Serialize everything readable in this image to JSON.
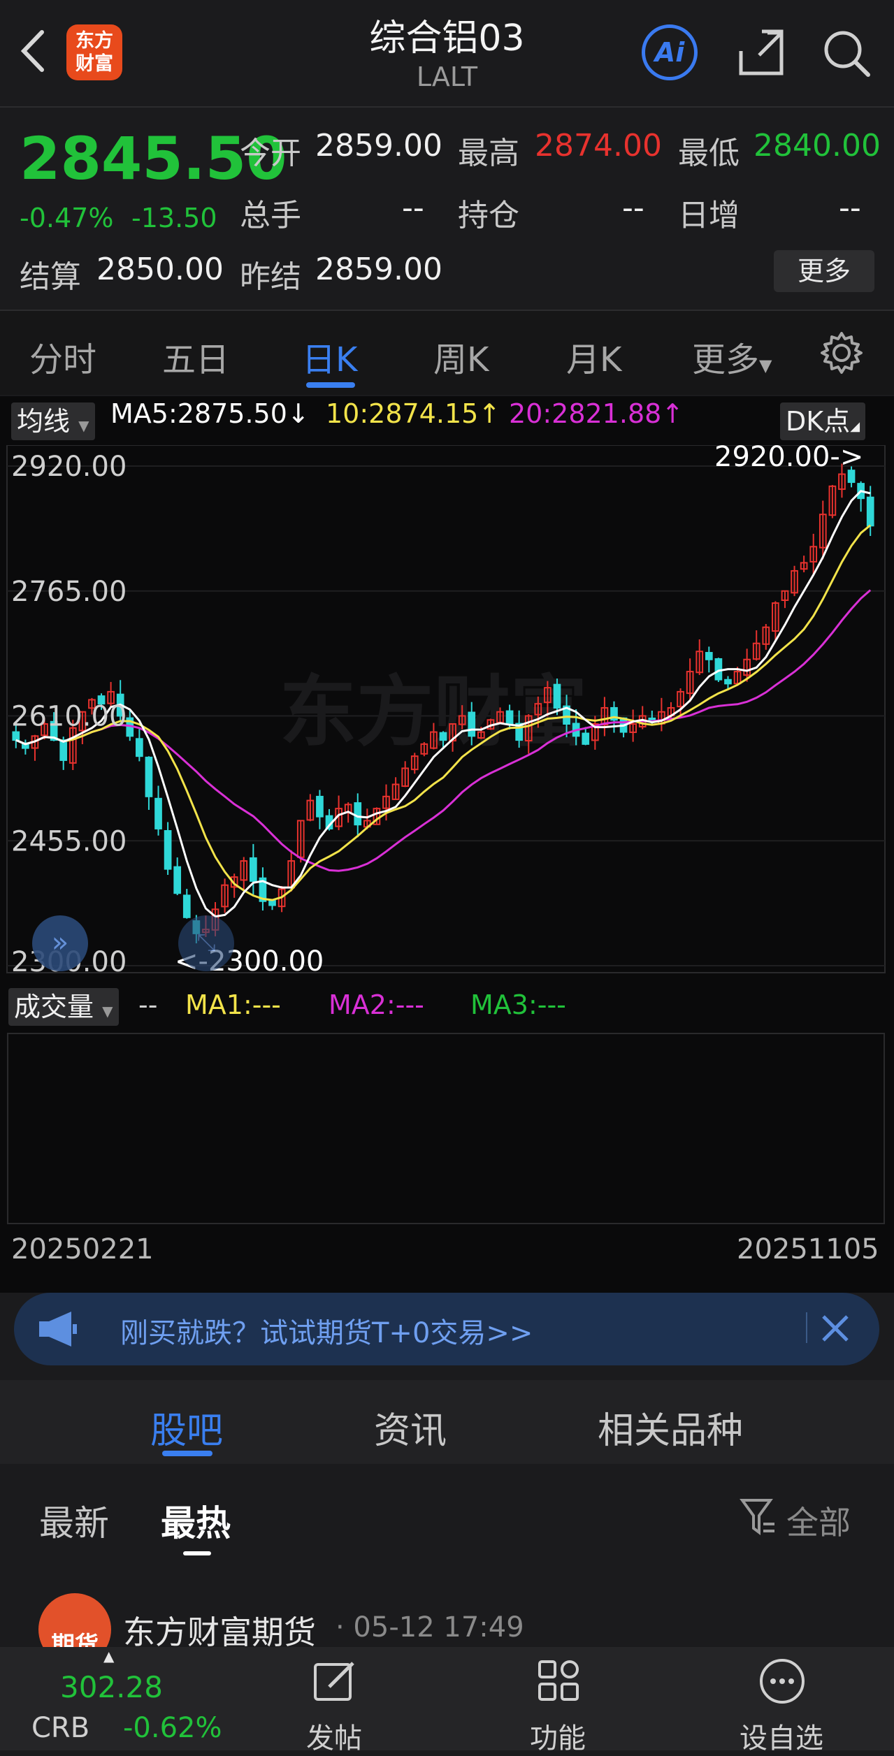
{
  "header": {
    "back_icon": "chevron-left-icon",
    "logo_line1": "东方",
    "logo_line2": "财富",
    "title": "综合铝03",
    "subtitle": "LALT",
    "ai_label": "Ai",
    "share_icon": "share-icon",
    "search_icon": "search-icon"
  },
  "quote": {
    "price": "2845.50",
    "change_pct": "-0.47%",
    "change_abs": "-13.50",
    "open_label": "今开",
    "open": "2859.00",
    "high_label": "最高",
    "high": "2874.00",
    "low_label": "最低",
    "low": "2840.00",
    "volume_label": "总手",
    "volume": "--",
    "oi_label": "持仓",
    "oi": "--",
    "daily_inc_label": "日增",
    "daily_inc": "--",
    "settle_label": "结算",
    "settle": "2850.00",
    "prev_settle_label": "昨结",
    "prev_settle": "2859.00",
    "more_label": "更多"
  },
  "period_tabs": [
    "分时",
    "五日",
    "日K",
    "周K",
    "月K",
    "更多"
  ],
  "active_period": "日K",
  "chart_legend": {
    "ma_button": "均线",
    "ma5": "MA5:2875.50↓",
    "ma10": "10:2874.15↑",
    "ma20": "20:2821.88↑",
    "dk_button": "DK点",
    "vol_button": "成交量",
    "vol_dash": "--",
    "vol_ma1": "MA1:---",
    "vol_ma2": "MA2:---",
    "vol_ma3": "MA3:---",
    "high_marker": "2920.00->",
    "low_marker": "<-2300.00",
    "watermark": "东方财富",
    "date_start": "20250221",
    "date_end": "20251105"
  },
  "colors": {
    "up": "#e8322e",
    "down": "#2fd8d8",
    "ma5": "#ffffff",
    "ma10": "#f2e34a",
    "ma20": "#d930d6",
    "accent": "#3a7ff0"
  },
  "chart_data": {
    "type": "candlestick",
    "ylim": [
      2300,
      2920
    ],
    "y_ticks": [
      "2920.00",
      "2765.00",
      "2610.00",
      "2455.00",
      "2300.00"
    ],
    "x_range": [
      "20250221",
      "20251105"
    ],
    "close_estimate": [
      2580,
      2570,
      2585,
      2600,
      2580,
      2555,
      2595,
      2615,
      2630,
      2625,
      2640,
      2610,
      2585,
      2560,
      2510,
      2470,
      2420,
      2390,
      2360,
      2340,
      2345,
      2370,
      2400,
      2410,
      2430,
      2405,
      2380,
      2375,
      2395,
      2430,
      2480,
      2505,
      2485,
      2470,
      2495,
      2500,
      2475,
      2480,
      2495,
      2510,
      2525,
      2545,
      2560,
      2575,
      2590,
      2580,
      2600,
      2610,
      2585,
      2590,
      2605,
      2615,
      2600,
      2580,
      2610,
      2625,
      2645,
      2620,
      2600,
      2585,
      2575,
      2600,
      2620,
      2605,
      2590,
      2600,
      2610,
      2605,
      2615,
      2620,
      2640,
      2665,
      2690,
      2680,
      2655,
      2650,
      2665,
      2680,
      2700,
      2720,
      2750,
      2765,
      2790,
      2800,
      2820,
      2860,
      2895,
      2910,
      2900,
      2880,
      2846
    ],
    "ma5_last": 2875.5,
    "ma10_last": 2874.15,
    "ma20_last": 2821.88
  },
  "banner": {
    "icon": "megaphone-icon",
    "text": "刚买就跌？试试期货T+0交易>>",
    "close_icon": "close-icon"
  },
  "section_tabs": [
    "股吧",
    "资讯",
    "相关品种"
  ],
  "feed_filters": [
    "最新",
    "最热"
  ],
  "active_filter": "最热",
  "filter_all": "全部",
  "post": {
    "author": "东方财富期货",
    "time": "· 05-12 17:49",
    "avatar_text": "期货"
  },
  "bottom_bar": {
    "index_value": "302.28",
    "index_name": "CRB",
    "index_change": "-0.62%",
    "post_label": "发帖",
    "func_label": "功能",
    "watch_label": "设自选"
  }
}
